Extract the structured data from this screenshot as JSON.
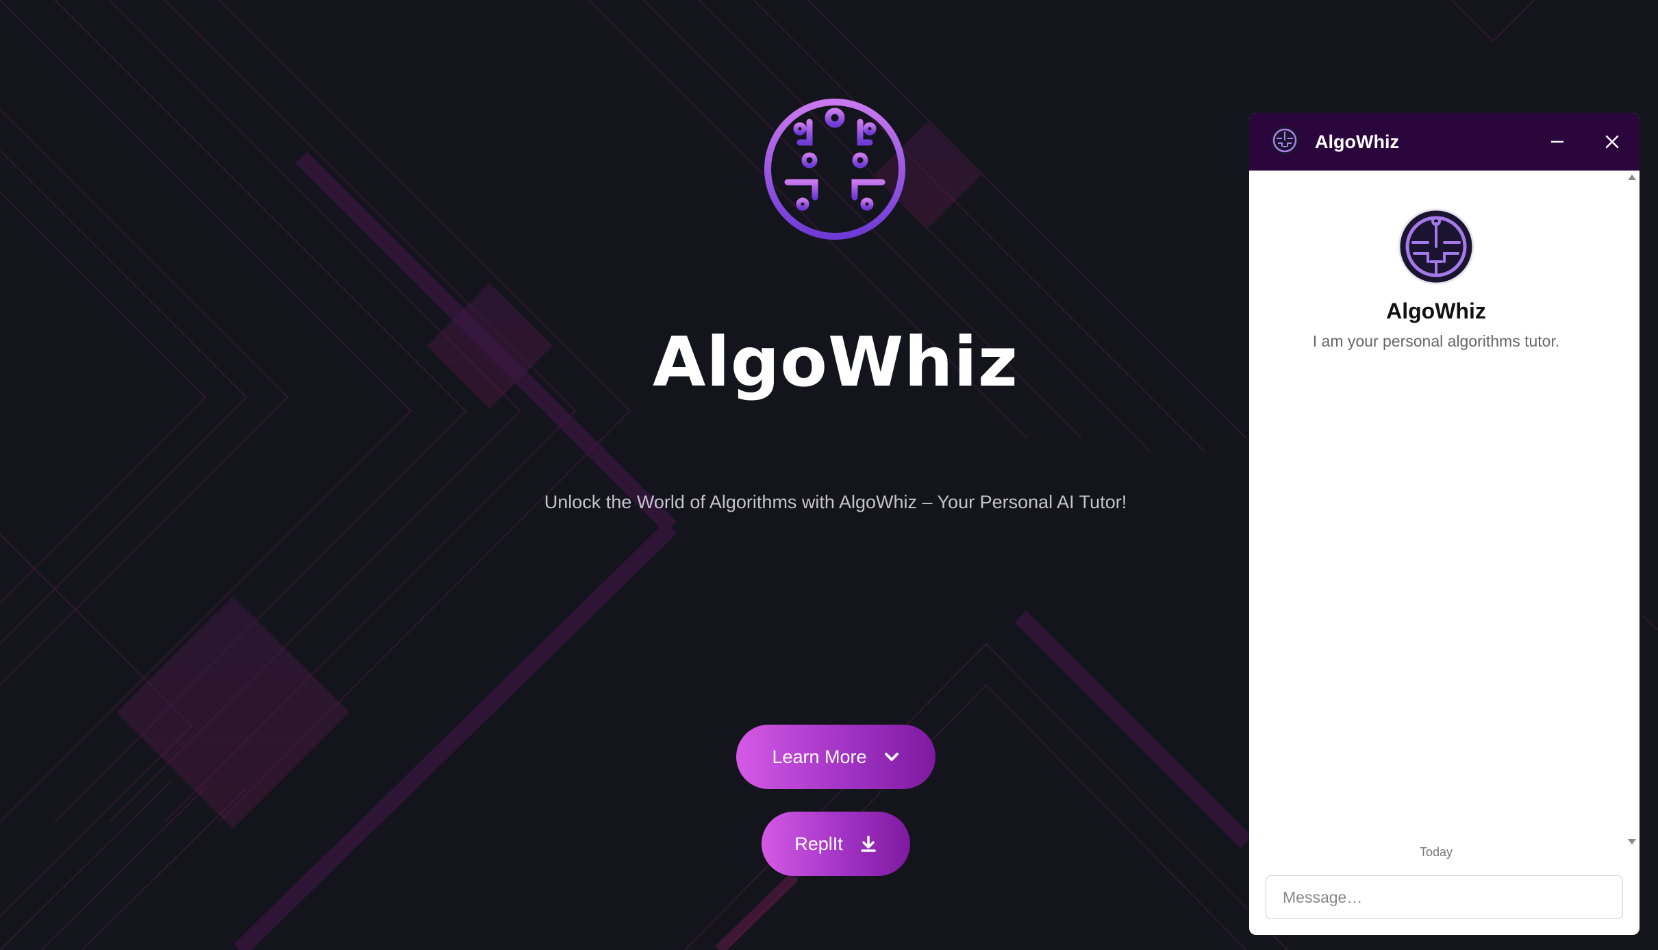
{
  "hero": {
    "title": "AlgoWhiz",
    "subtitle": "Unlock the World of Algorithms with AlgoWhiz – Your Personal AI Tutor!",
    "learn_more_label": "Learn More",
    "replit_label": "ReplIt"
  },
  "chat": {
    "header_title": "AlgoWhiz",
    "bot_name": "AlgoWhiz",
    "bot_description": "I am your personal algorithms tutor.",
    "date_divider": "Today",
    "message_placeholder": "Message…"
  },
  "colors": {
    "background": "#14141c",
    "header": "#2a063c",
    "button_gradient_start": "#d45ae6",
    "button_gradient_end": "#7e1aa1",
    "logo_gradient_top": "#c979ee",
    "logo_gradient_bottom": "#6e3ad6"
  },
  "icons": {
    "logo": "circuit-brain-icon",
    "learn_more": "chevron-down-icon",
    "replit": "download-icon",
    "minimize": "minimize-icon",
    "close": "close-icon"
  }
}
